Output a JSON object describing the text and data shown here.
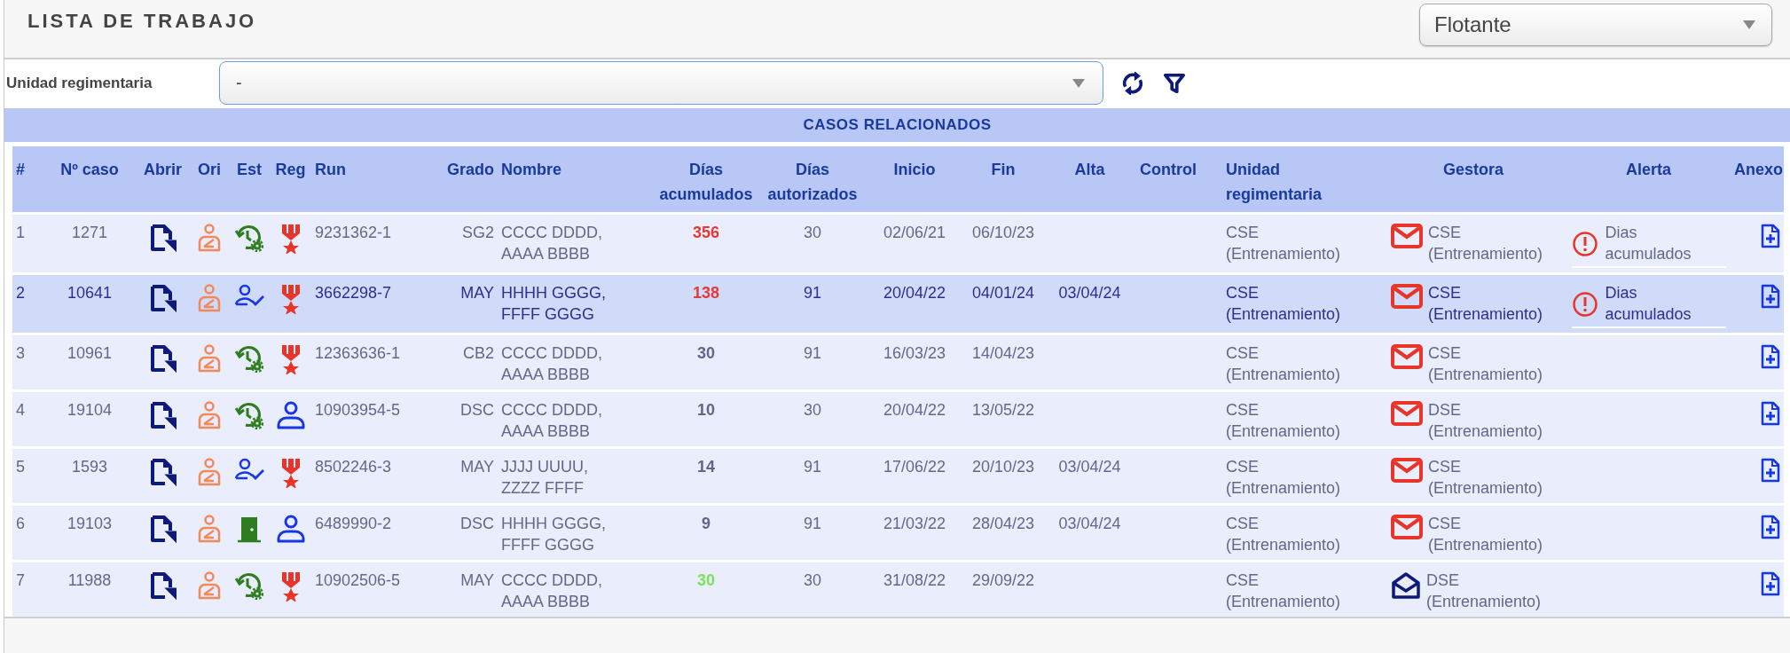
{
  "header": {
    "title": "LISTA DE TRABAJO",
    "mode_select": {
      "value": "Flotante"
    }
  },
  "filter": {
    "label": "Unidad regimentaria",
    "value": "-"
  },
  "table": {
    "title": "CASOS RELACIONADOS",
    "columns": [
      "#",
      "Nº caso",
      "Abrir",
      "Ori",
      "Est",
      "Reg",
      "Run",
      "Grado",
      "Nombre",
      "Días acumulados",
      "Días autorizados",
      "Inicio",
      "Fin",
      "Alta",
      "Control",
      "Unidad regimentaria",
      "Gestora",
      "Alerta",
      "Anexo"
    ],
    "rows": [
      {
        "num": "1",
        "caso": "1271",
        "est": {
          "kind": "history"
        },
        "reg": {
          "kind": "medal"
        },
        "run": "9231362-1",
        "grado": "SG2",
        "nombre": "CCCC DDDD, AAAA BBBB",
        "dias_acumulados": {
          "text": "356",
          "color": "#e53935"
        },
        "dias_autorizados": "30",
        "inicio": "02/06/21",
        "fin": "06/10/23",
        "unidad": "CSE (Entrenamiento)",
        "gestora": {
          "read": false,
          "text": "CSE (Entrenamiento)"
        },
        "alerta": "Dias acumulados",
        "selected": false
      },
      {
        "num": "2",
        "caso": "10641",
        "est": {
          "kind": "person-check"
        },
        "reg": {
          "kind": "medal"
        },
        "run": "3662298-7",
        "grado": "MAY",
        "nombre": "HHHH GGGG, FFFF GGGG",
        "dias_acumulados": {
          "text": "138",
          "color": "#e53935"
        },
        "dias_autorizados": "91",
        "inicio": "20/04/22",
        "fin": "04/01/24",
        "alta": "03/04/24",
        "unidad": "CSE (Entrenamiento)",
        "gestora": {
          "read": false,
          "text": "CSE (Entrenamiento)"
        },
        "alerta": "Dias acumulados",
        "selected": true
      },
      {
        "num": "3",
        "caso": "10961",
        "est": {
          "kind": "history"
        },
        "reg": {
          "kind": "medal"
        },
        "run": "12363636-1",
        "grado": "CB2",
        "nombre": "CCCC DDDD, AAAA BBBB",
        "dias_acumulados": {
          "text": "30",
          "color": "#626686"
        },
        "dias_autorizados": "91",
        "inicio": "16/03/23",
        "fin": "14/04/23",
        "unidad": "CSE (Entrenamiento)",
        "gestora": {
          "read": false,
          "text": "CSE (Entrenamiento)"
        },
        "selected": false
      },
      {
        "num": "4",
        "caso": "19104",
        "est": {
          "kind": "history"
        },
        "reg": {
          "kind": "person"
        },
        "run": "10903954-5",
        "grado": "DSC",
        "nombre": "CCCC DDDD, AAAA BBBB",
        "dias_acumulados": {
          "text": "10",
          "color": "#626686"
        },
        "dias_autorizados": "30",
        "inicio": "20/04/22",
        "fin": "13/05/22",
        "unidad": "CSE (Entrenamiento)",
        "gestora": {
          "read": false,
          "text": "DSE (Entrenamiento)"
        },
        "selected": false
      },
      {
        "num": "5",
        "caso": "1593",
        "est": {
          "kind": "person-check"
        },
        "reg": {
          "kind": "medal"
        },
        "run": "8502246-3",
        "grado": "MAY",
        "nombre": "JJJJ UUUU, ZZZZ FFFF",
        "dias_acumulados": {
          "text": "14",
          "color": "#626686"
        },
        "dias_autorizados": "91",
        "inicio": "17/06/22",
        "fin": "20/10/23",
        "alta": "03/04/24",
        "unidad": "CSE (Entrenamiento)",
        "gestora": {
          "read": false,
          "text": "CSE (Entrenamiento)"
        },
        "selected": false
      },
      {
        "num": "6",
        "caso": "19103",
        "est": {
          "kind": "door"
        },
        "reg": {
          "kind": "person"
        },
        "run": "6489990-2",
        "grado": "DSC",
        "nombre": "HHHH GGGG, FFFF GGGG",
        "dias_acumulados": {
          "text": "9",
          "color": "#626686"
        },
        "dias_autorizados": "91",
        "inicio": "21/03/22",
        "fin": "28/04/23",
        "alta": "03/04/24",
        "unidad": "CSE (Entrenamiento)",
        "gestora": {
          "read": false,
          "text": "CSE (Entrenamiento)"
        },
        "selected": false
      },
      {
        "num": "7",
        "caso": "11988",
        "est": {
          "kind": "history"
        },
        "reg": {
          "kind": "medal"
        },
        "run": "10902506-5",
        "grado": "MAY",
        "nombre": "CCCC DDDD, AAAA BBBB",
        "dias_acumulados": {
          "text": "30",
          "color": "#7de05a"
        },
        "dias_autorizados": "30",
        "inicio": "31/08/22",
        "fin": "29/09/22",
        "unidad": "CSE (Entrenamiento)",
        "gestora": {
          "read": true,
          "text": "DSE (Entrenamiento)"
        },
        "selected": false
      }
    ]
  }
}
